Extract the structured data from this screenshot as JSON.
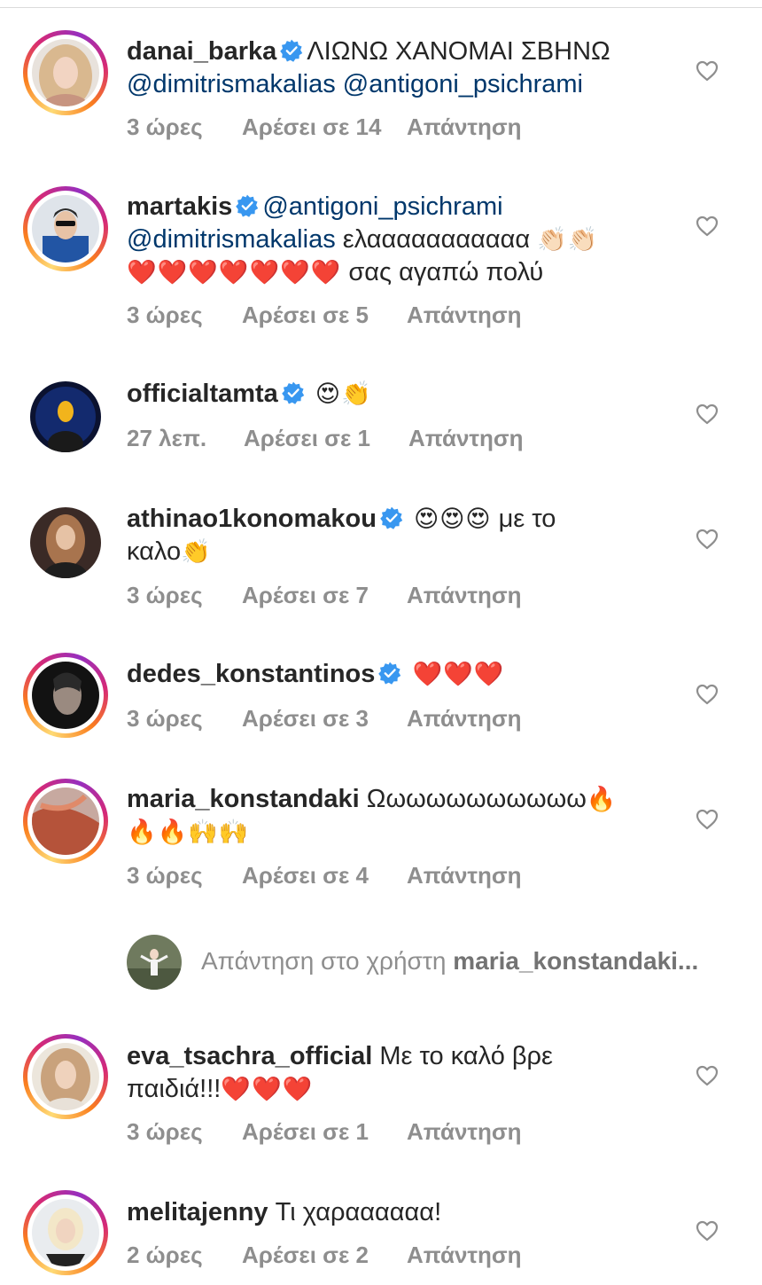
{
  "colors": {
    "text": "#262626",
    "meta": "#8e8e8e",
    "mention": "#00376b",
    "verified": "#3897f0",
    "heart": "#8e8e8e"
  },
  "comments": [
    {
      "username": "danai_barka",
      "verified": true,
      "story_ring": true,
      "line1": "ΛΙΩΝΩ ΧΑΝΟΜΑΙ ΣΒΗΝΩ",
      "line2": "@dimitrismakalias @antigoni_psichrami",
      "time": "3 ώρες",
      "likes": "Αρέσει σε 14",
      "reply": "Απάντηση"
    },
    {
      "username": "martakis",
      "verified": true,
      "story_ring": true,
      "line1": "@antigoni_psichrami",
      "line2_mention": "@dimitrismakalias",
      "line2_text": " ελααααααααααα ",
      "line2_emoji": "👏🏻👏🏻",
      "line3_emoji": "❤️❤️❤️❤️❤️❤️❤️",
      "line3_text": " σας αγαπώ πολύ",
      "time": "3 ώρες",
      "likes": "Αρέσει σε 5",
      "reply": "Απάντηση"
    },
    {
      "username": "officialtamta",
      "verified": true,
      "story_ring": false,
      "emoji": "😍👏",
      "time": "27 λεπ.",
      "likes": "Αρέσει σε 1",
      "reply": "Απάντηση"
    },
    {
      "username": "athinao1konomakou",
      "verified": true,
      "story_ring": false,
      "emoji": "😍😍😍",
      "text_after": " με το",
      "line2_text": "καλο",
      "line2_emoji": "👏",
      "time": "3 ώρες",
      "likes": "Αρέσει σε 7",
      "reply": "Απάντηση"
    },
    {
      "username": "dedes_konstantinos",
      "verified": true,
      "story_ring": true,
      "emoji": "❤️❤️❤️",
      "time": "3 ώρες",
      "likes": "Αρέσει σε 3",
      "reply": "Απάντηση"
    },
    {
      "username": "maria_konstandaki",
      "verified": false,
      "story_ring": true,
      "text": "Ωωωωωωωωωωω",
      "emoji": "🔥",
      "line2_emoji": "🔥🔥🙌🙌",
      "time": "3 ώρες",
      "likes": "Αρέσει σε 4",
      "reply": "Απάντηση"
    },
    {
      "username": "eva_tsachra_official",
      "verified": false,
      "story_ring": true,
      "text": "Με το καλό βρε",
      "line2_text": "παιδιά!!!",
      "line2_emoji": "❤️❤️❤️",
      "time": "3 ώρες",
      "likes": "Αρέσει σε 1",
      "reply": "Απάντηση"
    },
    {
      "username": "melitajenny",
      "verified": false,
      "story_ring": true,
      "text": "Τι χαραααααα!",
      "time": "2 ώρες",
      "likes": "Αρέσει σε 2",
      "reply": "Απάντηση"
    }
  ],
  "reply_box": {
    "prefix": "Απάντηση στο χρήστη ",
    "username": "maria_konstandaki..."
  }
}
